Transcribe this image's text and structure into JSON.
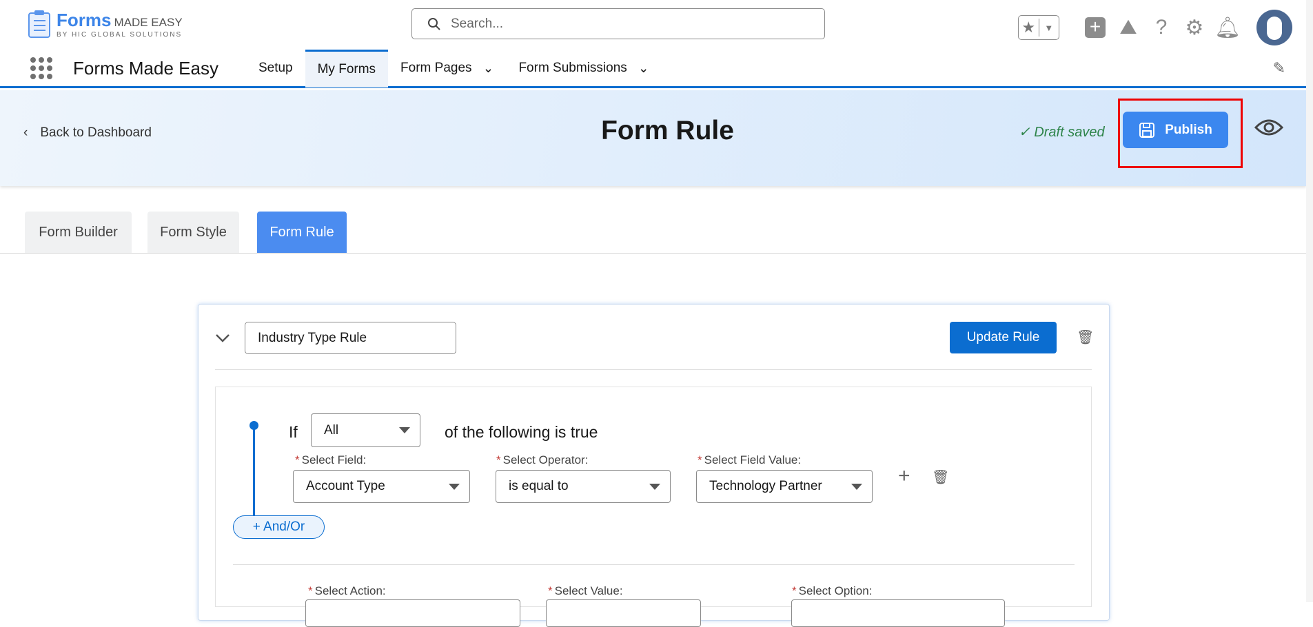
{
  "header": {
    "logo_word": "Forms",
    "logo_made": "MADE EASY",
    "logo_sub": "BY HIC GLOBAL SOLUTIONS",
    "search_placeholder": "Search..."
  },
  "nav": {
    "app_name": "Forms Made Easy",
    "items": [
      {
        "label": "Setup"
      },
      {
        "label": "My Forms"
      },
      {
        "label": "Form Pages"
      },
      {
        "label": "Form Submissions"
      }
    ]
  },
  "banner": {
    "back": "Back to Dashboard",
    "title": "Form Rule",
    "draft": "Draft saved",
    "publish": "Publish"
  },
  "tabs": [
    {
      "label": "Form Builder"
    },
    {
      "label": "Form Style"
    },
    {
      "label": "Form Rule"
    }
  ],
  "rule": {
    "name": "Industry Type Rule",
    "update": "Update Rule",
    "if": "If",
    "match": "All",
    "following": "of the following is true",
    "condition": {
      "field_label": "Select Field:",
      "field": "Account Type",
      "op_label": "Select Operator:",
      "op": "is equal to",
      "value_label": "Select Field Value:",
      "value": "Technology Partner"
    },
    "andor": "+ And/Or",
    "action": {
      "action_label": "Select Action:",
      "value_label": "Select Value:",
      "option_label": "Select Option:"
    }
  },
  "colors": {
    "brand": "#0b6dd0",
    "publish": "#3b87ef",
    "draft": "#2e844a"
  }
}
